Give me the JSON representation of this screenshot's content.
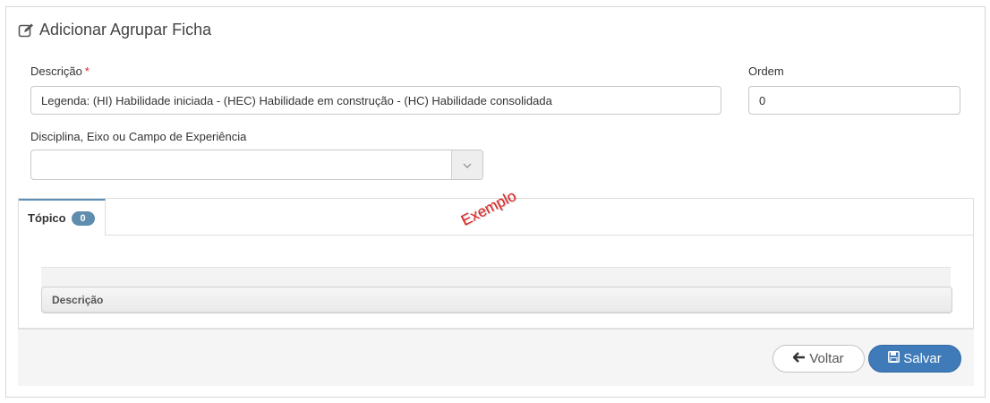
{
  "page": {
    "title": "Adicionar Agrupar Ficha",
    "title_icon": "edit-icon"
  },
  "form": {
    "descricao": {
      "label": "Descrição",
      "required_mark": "*",
      "value": "Legenda: (HI) Habilidade iniciada - (HEC) Habilidade em construção - (HC) Habilidade consolidada"
    },
    "ordem": {
      "label": "Ordem",
      "value": "0"
    },
    "disciplina": {
      "label": "Disciplina, Eixo ou Campo de Experiência",
      "value": "",
      "arrow_icon": "chevron-down-icon"
    }
  },
  "tabs": {
    "items": [
      {
        "label": "Tópico",
        "count": "0",
        "active": true
      }
    ]
  },
  "watermark": "Exemplo",
  "grid": {
    "columns": [
      "Descrição"
    ]
  },
  "footer": {
    "back_label": "Voltar",
    "back_icon": "arrow-left-icon",
    "save_label": "Salvar",
    "save_icon": "floppy-disk-icon"
  },
  "colors": {
    "accent": "#3f7ab9",
    "badge": "#5f8dad",
    "required": "#e02222",
    "watermark": "#e02020"
  }
}
